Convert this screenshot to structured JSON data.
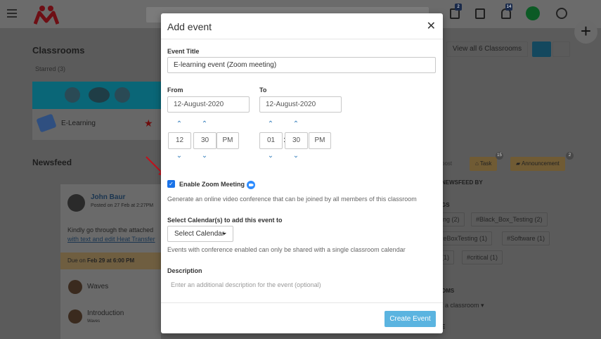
{
  "background": {
    "sidebar_title": "Classrooms",
    "starred": "Starred (3)",
    "classroom_name": "E-Learning",
    "view_all": "View all 6 Classrooms",
    "newsfeed_title": "Newsfeed",
    "post": {
      "author": "John Baur",
      "meta": "Posted on 27 Feb at 2:27PM",
      "text": "Kindly go through the attached",
      "link": "with text and edit Heat Transfer",
      "due_prefix": "Due on",
      "due_date": "Feb 29 at 6:00 PM"
    },
    "files": [
      {
        "name": "Waves",
        "sub": ""
      },
      {
        "name": "Introduction",
        "sub": "Waves"
      }
    ],
    "post_button": "post",
    "task_label": "Task",
    "task_count": "15",
    "announcement_label": "Announcement",
    "announcement_count": "2",
    "filter_head": "NEWSFEED BY",
    "tags_head": "GS",
    "hashtags": [
      "ing (2)",
      "#Black_Box_Testing (2)",
      "teBoxTesting (1)",
      "#Software (1)",
      "(1)",
      "#critical (1)"
    ],
    "classrooms_head": "OMS",
    "select_classroom": "t a classroom",
    "bottom_head": "E",
    "notif_counts": [
      "2",
      "14"
    ],
    "colors": {
      "accent": "#5bb4e0",
      "brand": "#d0162a"
    }
  },
  "modal": {
    "title": "Add event",
    "close_icon": "close-icon",
    "event_title_label": "Event Title",
    "event_title_value": "E-learning event (Zoom meeting)",
    "from_label": "From",
    "from_date": "12-August-2020",
    "to_label": "To",
    "to_date": "12-August-2020",
    "from_time": {
      "hour": "12",
      "minute": "30",
      "ampm": "PM"
    },
    "to_time": {
      "hour": "01",
      "minute": "30",
      "ampm": "PM"
    },
    "colon": ":",
    "zoom_enabled": true,
    "zoom_label": "Enable Zoom Meeting",
    "zoom_help": "Generate an online video conference that can be joined by all members of this classroom",
    "calendar_label": "Select Calendar(s) to add this event to",
    "calendar_button": "Select Calendar",
    "calendar_help": "Events with conference enabled can only be shared with a single classroom calendar",
    "description_label": "Description",
    "description_placeholder": "Enter an additional description for the event (optional)",
    "create_button": "Create Event"
  }
}
